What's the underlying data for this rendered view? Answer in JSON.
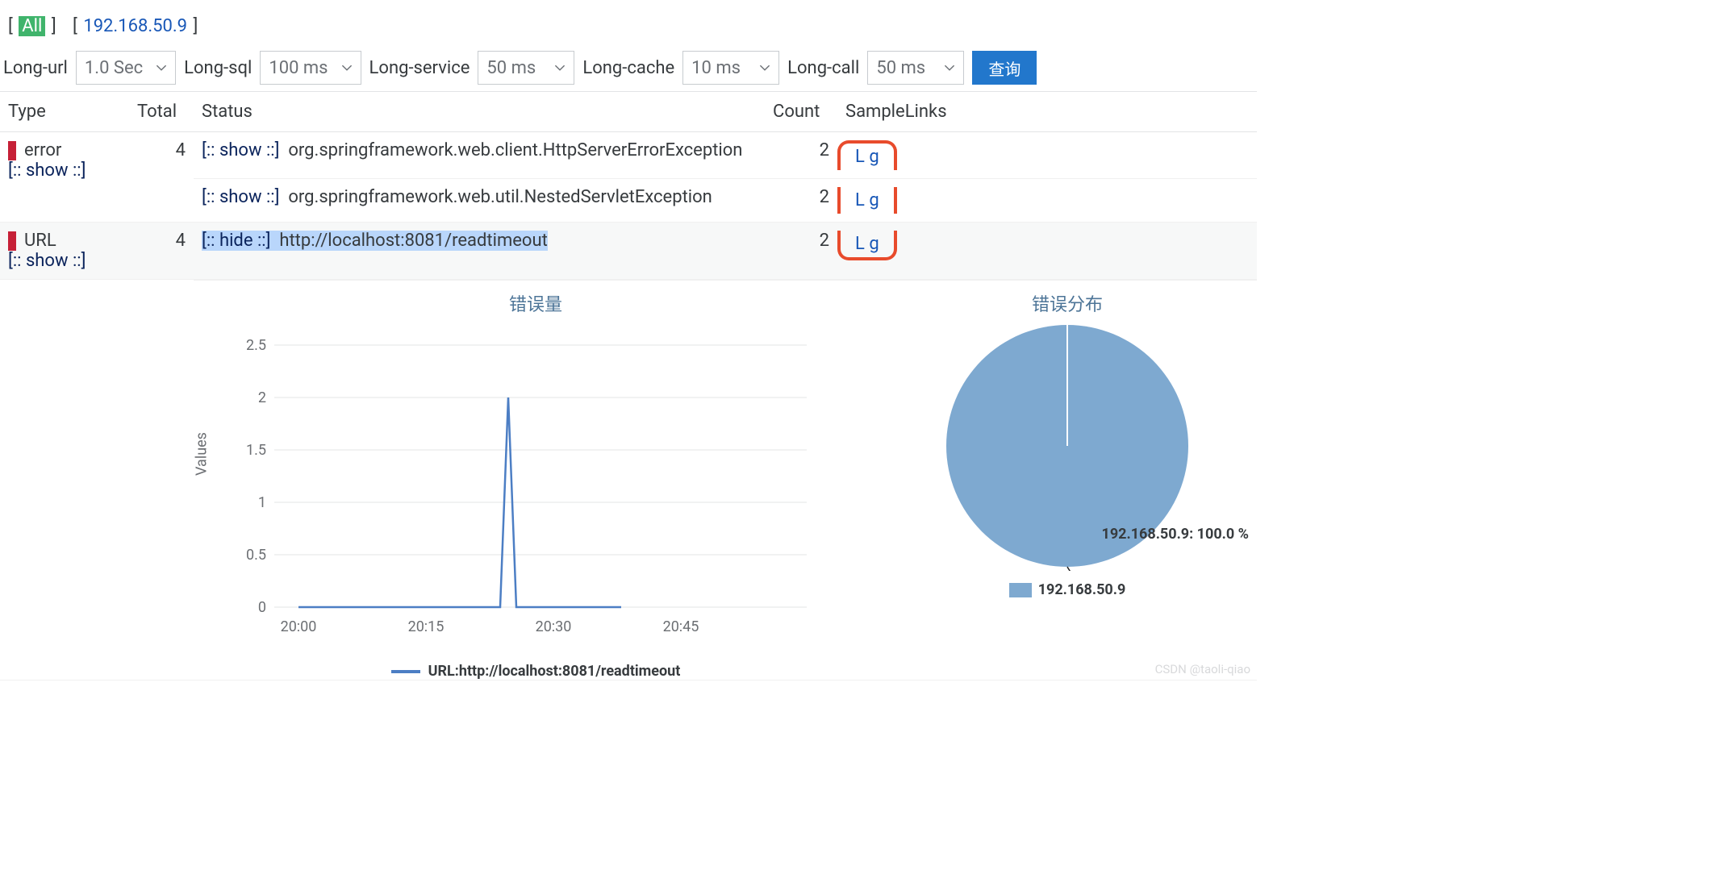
{
  "breadcrumb": {
    "all_label": "All",
    "ip": "192.168.50.9"
  },
  "filters": {
    "long_url": {
      "label": "Long-url",
      "value": "1.0 Sec"
    },
    "long_sql": {
      "label": "Long-sql",
      "value": "100 ms"
    },
    "long_service": {
      "label": "Long-service",
      "value": "50 ms"
    },
    "long_cache": {
      "label": "Long-cache",
      "value": "10 ms"
    },
    "long_call": {
      "label": "Long-call",
      "value": "50 ms"
    },
    "query_btn": "查询"
  },
  "table": {
    "headers": {
      "type": "Type",
      "total": "Total",
      "status": "Status",
      "count": "Count",
      "sample": "SampleLinks"
    },
    "show_link": "[:: show ::]",
    "hide_link": "[:: hide ::]",
    "rows": [
      {
        "type_label": "error",
        "total": "4",
        "status_rows": [
          {
            "toggle": "show",
            "text": "org.springframework.web.client.HttpServerErrorException",
            "count": "2",
            "L": "L",
            "g": "g"
          },
          {
            "toggle": "show",
            "text": "org.springframework.web.util.NestedServletException",
            "count": "2",
            "L": "L",
            "g": "g"
          }
        ]
      },
      {
        "type_label": "URL",
        "total": "4",
        "status_rows": [
          {
            "toggle": "hide",
            "text": "http://localhost:8081/readtimeout",
            "count": "2",
            "L": "L",
            "g": "g",
            "highlighted": true
          }
        ]
      }
    ]
  },
  "charts": {
    "line": {
      "title": "错误量",
      "ylabel": "Values",
      "legend": "URL:http://localhost:8081/readtimeout"
    },
    "pie": {
      "title": "错误分布",
      "callout": "192.168.50.9: 100.0 %",
      "legend": "192.168.50.9"
    }
  },
  "chart_data": [
    {
      "type": "line",
      "title": "错误量",
      "xlabel": "",
      "ylabel": "Values",
      "ylim": [
        0,
        2.5
      ],
      "x_ticks": [
        "20:00",
        "20:15",
        "20:30",
        "20:45"
      ],
      "y_ticks": [
        0,
        0.5,
        1,
        1.5,
        2,
        2.5
      ],
      "series": [
        {
          "name": "URL:http://localhost:8081/readtimeout",
          "color": "#4C7EC4",
          "x": [
            "20:00",
            "20:01",
            "20:02",
            "20:03",
            "20:04",
            "20:05",
            "20:06",
            "20:07",
            "20:08",
            "20:09",
            "20:10",
            "20:11",
            "20:12",
            "20:13",
            "20:14",
            "20:15",
            "20:16",
            "20:17",
            "20:18",
            "20:19",
            "20:20",
            "20:21",
            "20:22",
            "20:23",
            "20:24",
            "20:25",
            "20:26",
            "20:27",
            "20:28",
            "20:29",
            "20:30",
            "20:31",
            "20:32",
            "20:33",
            "20:34",
            "20:35",
            "20:36",
            "20:37",
            "20:38",
            "20:39",
            "20:40",
            "20:41",
            "20:42",
            "20:43",
            "20:44",
            "20:45",
            "20:46",
            "20:47",
            "20:48",
            "20:49",
            "20:50",
            "20:51",
            "20:52",
            "20:53",
            "20:54",
            "20:55",
            "20:56",
            "20:57",
            "20:58",
            "20:59"
          ],
          "values": [
            0,
            0,
            0,
            0,
            0,
            0,
            0,
            0,
            0,
            0,
            0,
            0,
            0,
            0,
            0,
            0,
            0,
            0,
            0,
            0,
            0,
            0,
            0,
            0,
            2,
            0,
            0,
            0,
            0,
            0,
            0,
            0,
            0,
            0,
            0,
            0,
            0,
            0,
            0,
            0,
            0,
            0,
            0,
            0,
            0,
            0,
            0,
            0,
            0,
            0,
            0,
            0,
            0,
            0,
            0,
            0,
            0,
            0,
            0,
            0
          ]
        }
      ]
    },
    {
      "type": "pie",
      "title": "错误分布",
      "categories": [
        "192.168.50.9"
      ],
      "values": [
        100.0
      ],
      "colors": [
        "#7EA9D0"
      ]
    }
  ],
  "watermark": "CSDN @taoli-qiao"
}
